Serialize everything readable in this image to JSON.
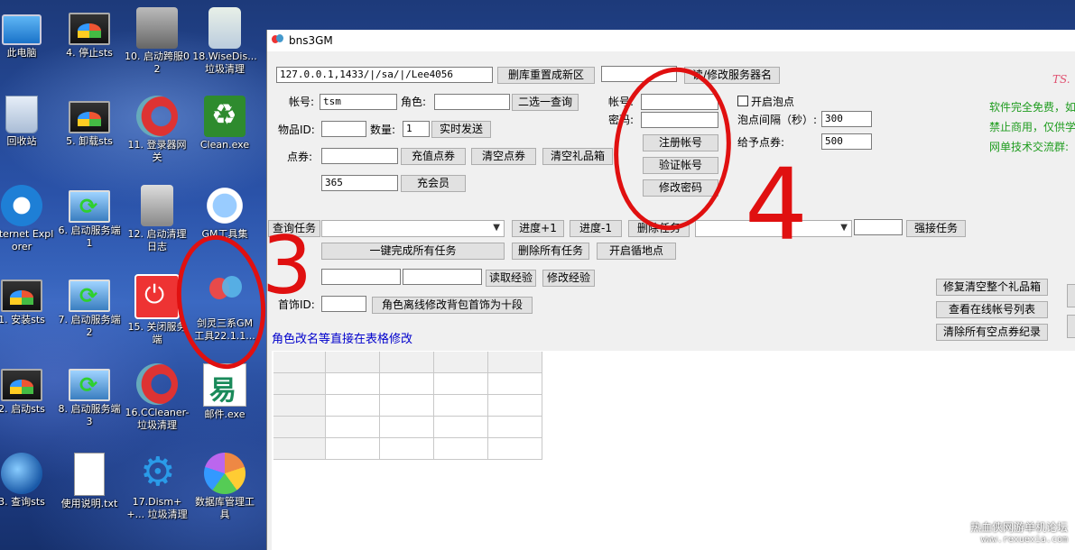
{
  "desktop": {
    "icons": [
      {
        "label": "此电脑"
      },
      {
        "label": "4. 停止sts"
      },
      {
        "label": "10. 启动跨服02"
      },
      {
        "label": "18.WiseDis... 垃圾清理"
      },
      {
        "label": "回收站"
      },
      {
        "label": "5. 卸载sts"
      },
      {
        "label": "11. 登录器网关"
      },
      {
        "label": "Clean.exe"
      },
      {
        "label": "Internet Explorer"
      },
      {
        "label": "6. 启动服务端1"
      },
      {
        "label": "12. 启动清理日志"
      },
      {
        "label": "GM工具集"
      },
      {
        "label": "1. 安装sts"
      },
      {
        "label": "7. 启动服务端2"
      },
      {
        "label": "15. 关闭服务端"
      },
      {
        "label": "剑灵三系GM工具22.1.1..."
      },
      {
        "label": "2. 启动sts"
      },
      {
        "label": "8. 启动服务端3"
      },
      {
        "label": "16.CCleaner-垃圾清理"
      },
      {
        "label": "邮件.exe"
      },
      {
        "label": "3. 查询sts"
      },
      {
        "label": "使用说明.txt"
      },
      {
        "label": "17.Dism++... 垃圾清理"
      },
      {
        "label": "数据库管理工具"
      }
    ]
  },
  "window": {
    "title": "bns3GM",
    "connection": "127.0.0.1,1433/|/sa/|/Lee4056",
    "btn_reset_db": "删库重置成新区",
    "btn_rename_server": "读/修改服务器名",
    "label_account": "帐号:",
    "account_value": "tsm",
    "label_role": "角色:",
    "btn_query": "二选一查询",
    "label_item_id": "物品ID:",
    "label_quantity": "数量:",
    "quantity_value": "1",
    "btn_send": "实时发送",
    "label_points": "点券:",
    "btn_recharge": "充值点券",
    "btn_clear_points": "清空点券",
    "btn_clear_giftbox": "清空礼品箱",
    "member_value": "365",
    "btn_member": "充会员",
    "label_account2": "帐号:",
    "label_password": "密码:",
    "btn_register": "注册帐号",
    "btn_verify": "验证帐号",
    "btn_change_pwd": "修改密码",
    "chk_bubble_label": "开启泡点",
    "label_bubble_interval": "泡点间隔（秒）:",
    "bubble_interval_value": "300",
    "label_give_points": "给予点券:",
    "give_points_value": "500",
    "right_text_1": "TS.",
    "right_text_2": "软件完全免费，如",
    "right_text_3": "禁止商用，仅供学",
    "right_text_4": "网单技术交流群:",
    "btn_query_task": "查询任务",
    "btn_progress_plus": "进度+1",
    "btn_progress_minus": "进度-1",
    "btn_delete_task": "删除任务",
    "btn_force_task": "强接任务",
    "btn_complete_all": "一键完成所有任务",
    "btn_delete_all": "删除所有任务",
    "btn_open_loop": "开启循地点",
    "btn_read_exp": "读取经验",
    "btn_modify_exp": "修改经验",
    "label_head_id": "首饰ID:",
    "btn_modify_head": "角色离线修改背包首饰为十段",
    "btn_repair_giftbox": "修复清空整个礼品箱",
    "btn_online_list": "查看在线帐号列表",
    "btn_clear_empty": "清除所有空点券纪录",
    "hint_text": "角色改名等直接在表格修改"
  },
  "annotations": {
    "mark_3": "3",
    "mark_4": "4",
    "watermark_1": "热血侠网游单机论坛",
    "watermark_2": "www.rexuexia.com"
  }
}
